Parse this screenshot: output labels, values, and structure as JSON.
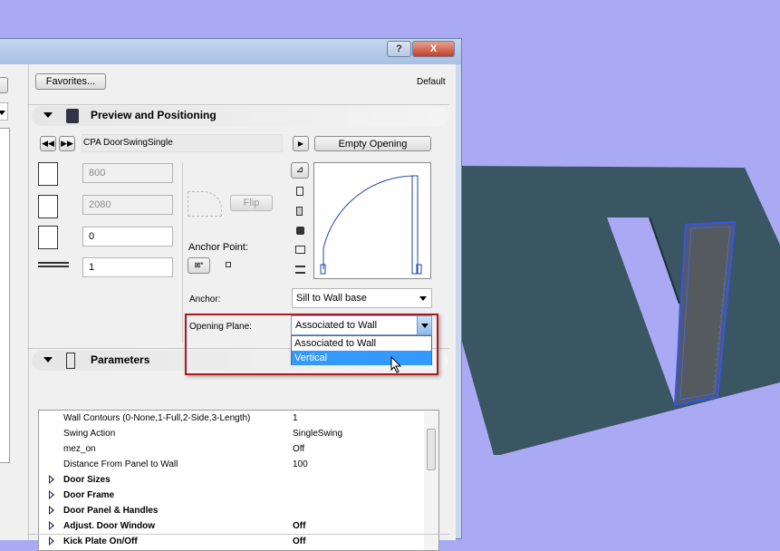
{
  "dialog": {
    "help_label": "?",
    "close_label": "X"
  },
  "toolbar": {
    "favorites_label": "Favorites...",
    "default_label": "Default"
  },
  "preview": {
    "section_title": "Preview and Positioning",
    "object_name": "CPA DoorSwingSingle",
    "empty_opening_label": "Empty Opening",
    "width": "800",
    "height": "2080",
    "sill_height": "0",
    "reveal": "1",
    "flip_label": "Flip",
    "anchor_point_label": "Anchor Point:",
    "anchor_label": "Anchor:",
    "anchor_value": "Sill to Wall base",
    "opening_plane_label": "Opening Plane:",
    "opening_plane_value": "Associated to Wall",
    "opening_plane_options": [
      "Associated to Wall",
      "Vertical"
    ],
    "highlighted_option": "Vertical"
  },
  "parameters": {
    "section_title": "Parameters",
    "rows": [
      {
        "name": "Wall Contours (0-None,1-Full,2-Side,3-Length)",
        "value": "1"
      },
      {
        "name": "Swing Action",
        "value": "SingleSwing"
      },
      {
        "name": "mez_on",
        "value": "Off"
      },
      {
        "name": "Distance From Panel to Wall",
        "value": "100"
      },
      {
        "name": "Door Sizes",
        "value": ""
      },
      {
        "name": "Door Frame",
        "value": ""
      },
      {
        "name": "Door Panel & Handles",
        "value": ""
      },
      {
        "name": "Adjust. Door Window",
        "value": "Off"
      },
      {
        "name": "Kick Plate On/Off",
        "value": "Off"
      }
    ]
  },
  "colors": {
    "background": "#aaaaf4",
    "wall": "#3a5663",
    "door": "#555a5e",
    "door_outline": "#3355ee",
    "highlight": "#3399ff",
    "callout": "#b01820"
  }
}
